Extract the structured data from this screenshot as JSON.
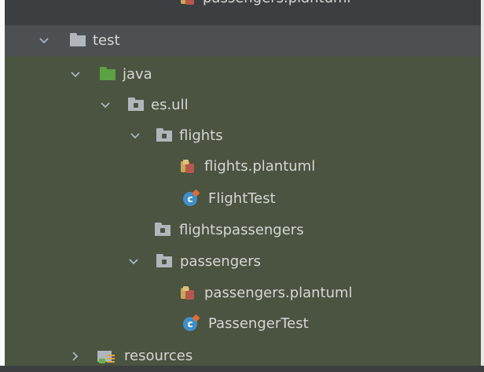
{
  "colors": {
    "panel_bg": "#3c3f41",
    "test_scope_bg": "#4a5440",
    "selected_row_bg": "#4c5052",
    "folder_grey": "#b0b6bb",
    "source_root_green": "#5ca143",
    "class_blue": "#3f8fc8",
    "text": "#d6d6d6"
  },
  "tree": {
    "rows": [
      {
        "label": "passengers.plantuml",
        "icon": "plantuml-file-icon",
        "chevron": "none"
      },
      {
        "label": "test",
        "icon": "folder-icon",
        "chevron": "expanded"
      },
      {
        "label": "java",
        "icon": "test-source-folder-icon",
        "chevron": "expanded"
      },
      {
        "label": "es.ull",
        "icon": "package-icon",
        "chevron": "expanded"
      },
      {
        "label": "flights",
        "icon": "package-icon",
        "chevron": "expanded"
      },
      {
        "label": "flights.plantuml",
        "icon": "plantuml-file-icon",
        "chevron": "none"
      },
      {
        "label": "FlightTest",
        "icon": "test-class-icon",
        "chevron": "none"
      },
      {
        "label": "flightspassengers",
        "icon": "package-icon",
        "chevron": "none"
      },
      {
        "label": "passengers",
        "icon": "package-icon",
        "chevron": "expanded"
      },
      {
        "label": "passengers.plantuml",
        "icon": "plantuml-file-icon",
        "chevron": "none"
      },
      {
        "label": "PassengerTest",
        "icon": "test-class-icon",
        "chevron": "none"
      },
      {
        "label": "resources",
        "icon": "resources-folder-icon",
        "chevron": "collapsed"
      }
    ],
    "class_icon_letter": "c"
  }
}
